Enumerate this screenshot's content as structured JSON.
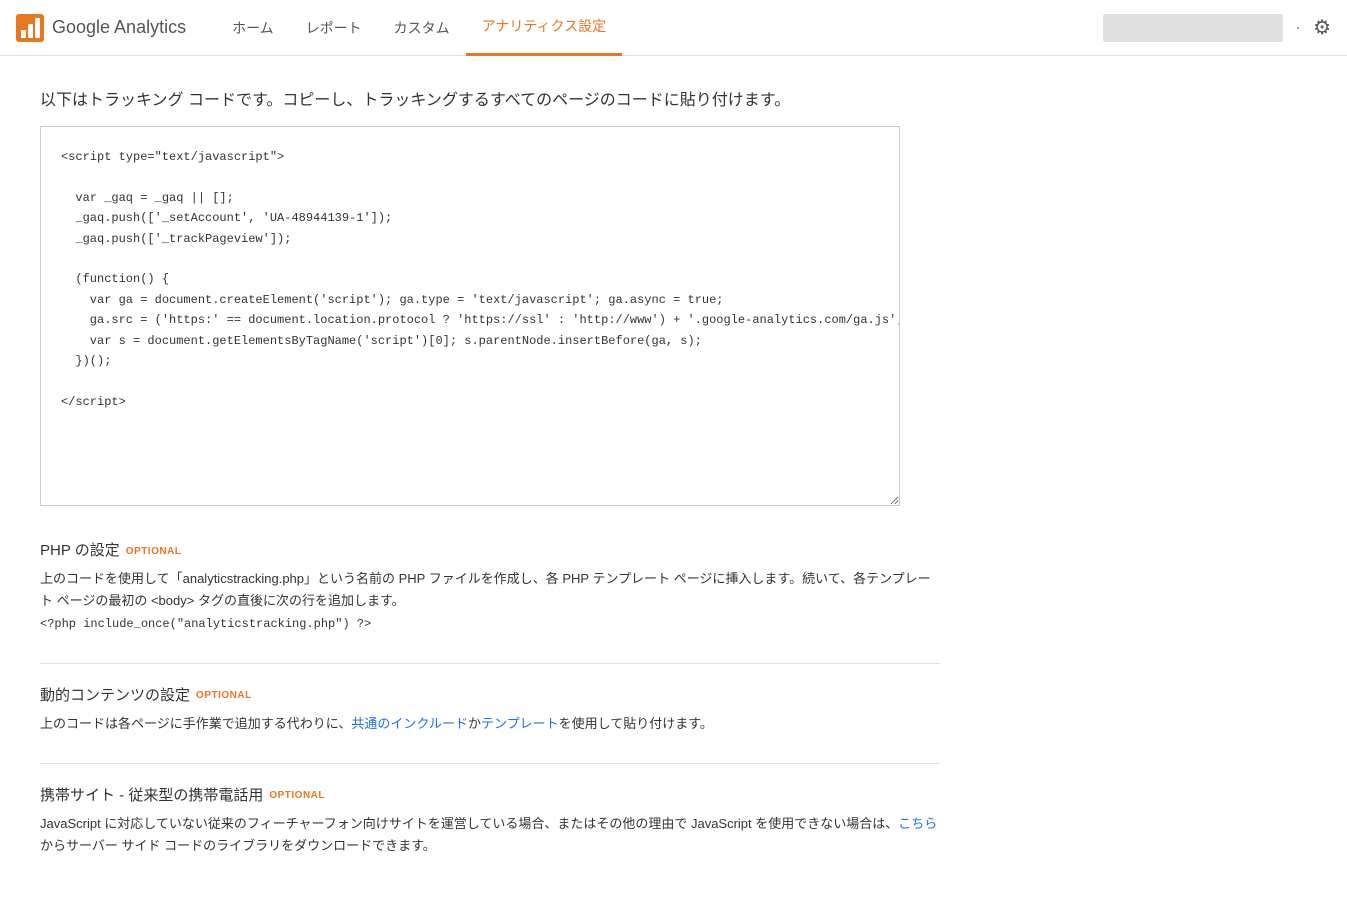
{
  "app": {
    "name": "Google Analytics"
  },
  "header": {
    "logo_text": "Google Analytics",
    "nav_items": [
      {
        "label": "ホーム",
        "active": false
      },
      {
        "label": "レポート",
        "active": false
      },
      {
        "label": "カスタム",
        "active": false
      },
      {
        "label": "アナリティクス設定",
        "active": true
      }
    ],
    "settings_icon": "⚙"
  },
  "main": {
    "description": "以下はトラッキング コードです。コピーし、トラッキングするすべてのページのコードに貼り付けます。",
    "tracking_code": "<script type=\"text/javascript\">\n\n  var _gaq = _gaq || [];\n  _gaq.push(['_setAccount', 'UA-48944139-1']);\n  _gaq.push(['_trackPageview']);\n\n  (function() {\n    var ga = document.createElement('script'); ga.type = 'text/javascript'; ga.async = true;\n    ga.src = ('https:' == document.location.protocol ? 'https://ssl' : 'http://www') + '.google-analytics.com/ga.js';\n    var s = document.getElementsByTagName('script')[0]; s.parentNode.insertBefore(ga, s);\n  })();\n\n</script>",
    "sections": [
      {
        "id": "php",
        "title": "PHP の設定",
        "optional": "OPTIONAL",
        "body_text": "上のコードを使用して「analyticstracking.php」という名前の PHP ファイルを作成し、各 PHP テンプレート ページに挿入します。続いて、各テンプレート ページの最初の <body> タグの直後に次の行を追加します。",
        "code_snippet": "<?php include_once(\"analyticstracking.php\") ?>"
      },
      {
        "id": "dynamic",
        "title": "動的コンテンツの設定",
        "optional": "OPTIONAL",
        "body_text_before": "上のコードは各ページに手作業で追加する代わりに、",
        "link1": "共通のインクルード",
        "body_text_middle": "か",
        "link2": "テンプレート",
        "body_text_after": "を使用して貼り付けます。"
      },
      {
        "id": "mobile",
        "title": "携帯サイト - 従来型の携帯電話用",
        "optional": "OPTIONAL",
        "body_text_before": "JavaScript に対応していない従来のフィーチャーフォン向けサイトを運営している場合、またはその他の理由で JavaScript を使用できない場合は、",
        "link": "こちら",
        "body_text_after": "からサーバー サイド コードのライブラリをダウンロードできます。"
      }
    ]
  }
}
